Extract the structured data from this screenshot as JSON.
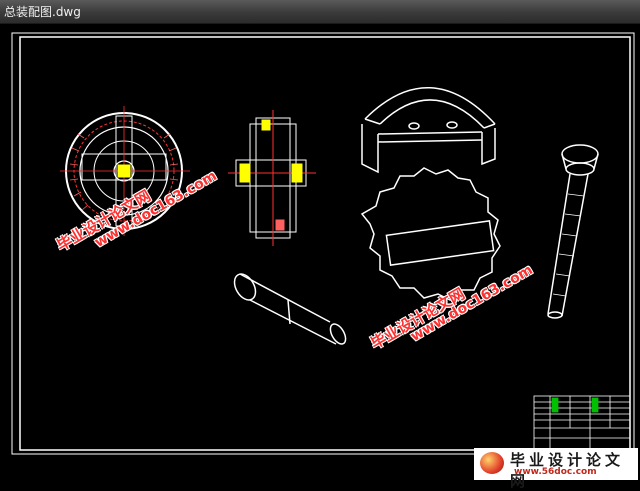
{
  "window": {
    "title": "总装配图.dwg"
  },
  "watermarks": {
    "site_name": "毕业设计论文网",
    "site_url": "www.doc163.com"
  },
  "logo": {
    "name": "毕业设计论文网",
    "url": "www.56doc.com"
  },
  "colors": {
    "background": "#000000",
    "linework": "#ffffff",
    "center_line": "#ff2a2a",
    "highlight": "#ffff00",
    "watermark": "#ff3030"
  }
}
